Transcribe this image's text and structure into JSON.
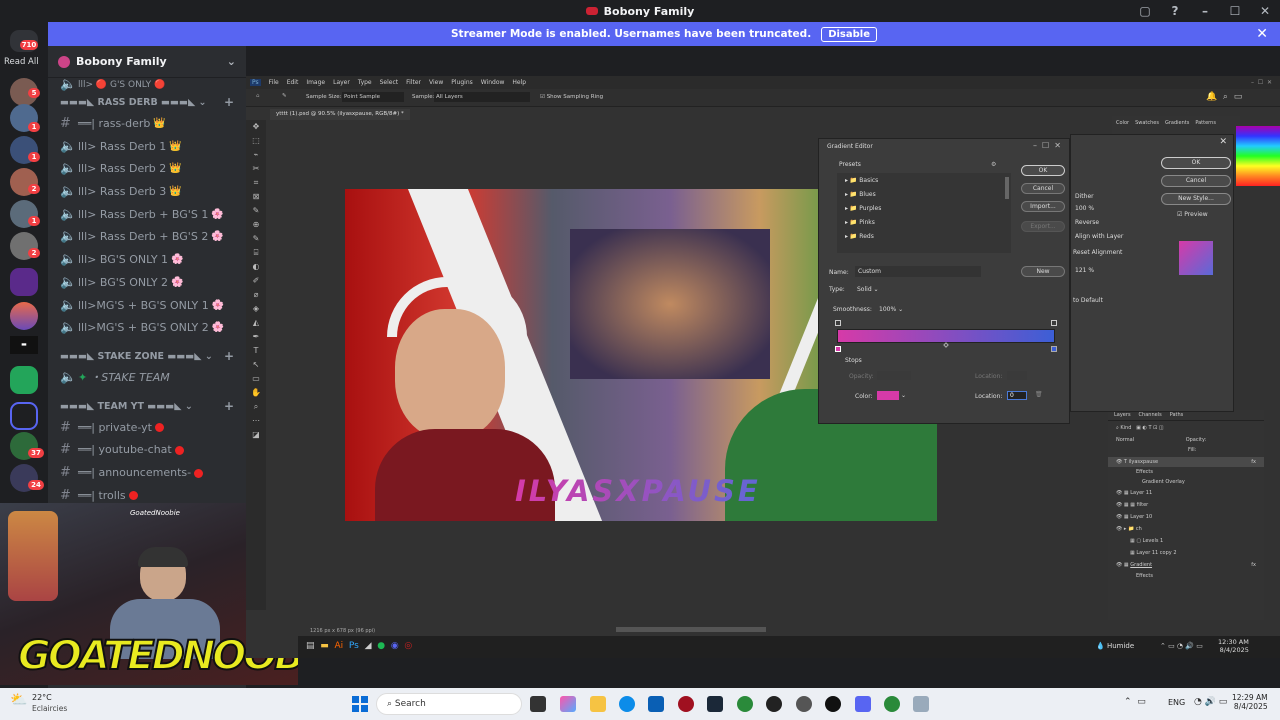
{
  "window": {
    "title": "Bobony Family",
    "controls": [
      "▢",
      "?",
      "–",
      "☐",
      "✕"
    ]
  },
  "streamer_banner": {
    "text": "Streamer Mode is enabled. Usernames have been truncated.",
    "button": "Disable",
    "close": "✕"
  },
  "servers": {
    "read_all": "Read All",
    "badges": [
      "710",
      "5",
      "1",
      "1",
      "2",
      "1",
      "2",
      "37",
      "24"
    ]
  },
  "guild": {
    "name": "Bobony Family",
    "chevron": "⌄"
  },
  "sidebar": {
    "top_partial": "lll> 🔴 G'S ONLY 🔴",
    "categories": [
      {
        "name": "▬▬▬◣ RASS DERB ▬▬▬◣ ⌄",
        "channels": [
          {
            "name": "══| rass-derb",
            "mark": "👑"
          },
          {
            "name": "lll> Rass Derb 1",
            "mark": "👑"
          },
          {
            "name": "lll> Rass Derb 2",
            "mark": "👑"
          },
          {
            "name": "lll> Rass Derb 3",
            "mark": "👑"
          },
          {
            "name": "lll> Rass Derb + BG'S 1",
            "mark": "🌸"
          },
          {
            "name": "lll> Rass Derb + BG'S 2",
            "mark": "🌸"
          },
          {
            "name": "lll> BG'S ONLY 1",
            "mark": "🌸"
          },
          {
            "name": "lll> BG'S ONLY 2",
            "mark": "🌸"
          },
          {
            "name": "lll>MG'S + BG'S ONLY 1",
            "mark": "🌸"
          },
          {
            "name": "lll>MG'S + BG'S ONLY 2",
            "mark": "🌸"
          }
        ]
      },
      {
        "name": "▬▬▬◣ STAKE ZONE ▬▬▬◣ ⌄",
        "channels": [
          {
            "name": "・STAKE TEAM",
            "mark": ""
          }
        ]
      },
      {
        "name": "▬▬▬◣ TEAM YT ▬▬▬◣ ⌄",
        "channels": [
          {
            "name": "══| private-yt",
            "mark": "🔴"
          },
          {
            "name": "══| youtube-chat",
            "mark": "🔴"
          },
          {
            "name": "══| announcements-",
            "mark": "🔴"
          },
          {
            "name": "══| trolls",
            "mark": "🔴"
          }
        ]
      }
    ]
  },
  "webcam": {
    "handle": "GoatedNoobie",
    "overlay_text": "GOATEDNOOBIE"
  },
  "photoshop": {
    "menu": [
      "Ps",
      "File",
      "Edit",
      "Image",
      "Layer",
      "Type",
      "Select",
      "Filter",
      "View",
      "Plugins",
      "Window",
      "Help"
    ],
    "options": {
      "sample_size_label": "Sample Size:",
      "sample_size": "Point Sample",
      "sample_label": "Sample:",
      "sample": "All Layers",
      "show_ring": "Show Sampling Ring"
    },
    "doc_tab": "ytttt (1).psd @ 90.5% (ilyasxpause, RGB/8#) *",
    "status": "1216 px x 678 px (96 ppi)",
    "canvas_text": "ILYASXPAUSE",
    "gradient_editor": {
      "title": "Gradient Editor",
      "presets_label": "Presets",
      "presets": [
        "Basics",
        "Blues",
        "Purples",
        "Pinks",
        "Reds"
      ],
      "buttons": {
        "ok": "OK",
        "cancel": "Cancel",
        "import": "Import...",
        "export": "Export...",
        "new": "New"
      },
      "name_label": "Name:",
      "name": "Custom",
      "type_label": "Type:",
      "type": "Solid",
      "smoothness_label": "Smoothness:",
      "smoothness": "100%",
      "stops_label": "Stops",
      "opacity_label": "Opacity:",
      "location_label": "Location:",
      "color_label": "Color:",
      "location_value": "0",
      "gradient_from": "#d63aa8",
      "gradient_to": "#3c5fd6"
    },
    "layer_style": {
      "buttons": {
        "ok": "OK",
        "cancel": "Cancel",
        "new_style": "New Style...",
        "preview": "Preview"
      },
      "options": [
        "Dither",
        "100 %",
        "Reverse",
        "Align with Layer",
        "Reset Alignment",
        "121 %",
        "to Default"
      ]
    },
    "right_tabs": [
      "Color",
      "Swatches",
      "Gradients",
      "Patterns"
    ],
    "layers": {
      "tabs": [
        "Layers",
        "Channels",
        "Paths"
      ],
      "kind": "Kind",
      "blend": "Normal",
      "opacity": "Opacity:",
      "fill": "Fill:",
      "items": [
        "ilyasxpause",
        "Effects",
        "Gradient Overlay",
        "Layer 11",
        "filter",
        "Layer 10",
        "ch",
        "Levels 1",
        "Layer 11 copy 2",
        "Gradient",
        "Effects"
      ]
    },
    "taskbar": {
      "weather": "Humide",
      "time": "12:30 AM",
      "date": "8/4/2025"
    }
  },
  "taskbar": {
    "temp": "22°C",
    "cond": "Eclaircies",
    "search": "Search",
    "lang": "ENG",
    "time": "12:29 AM",
    "date": "8/4/2025"
  }
}
